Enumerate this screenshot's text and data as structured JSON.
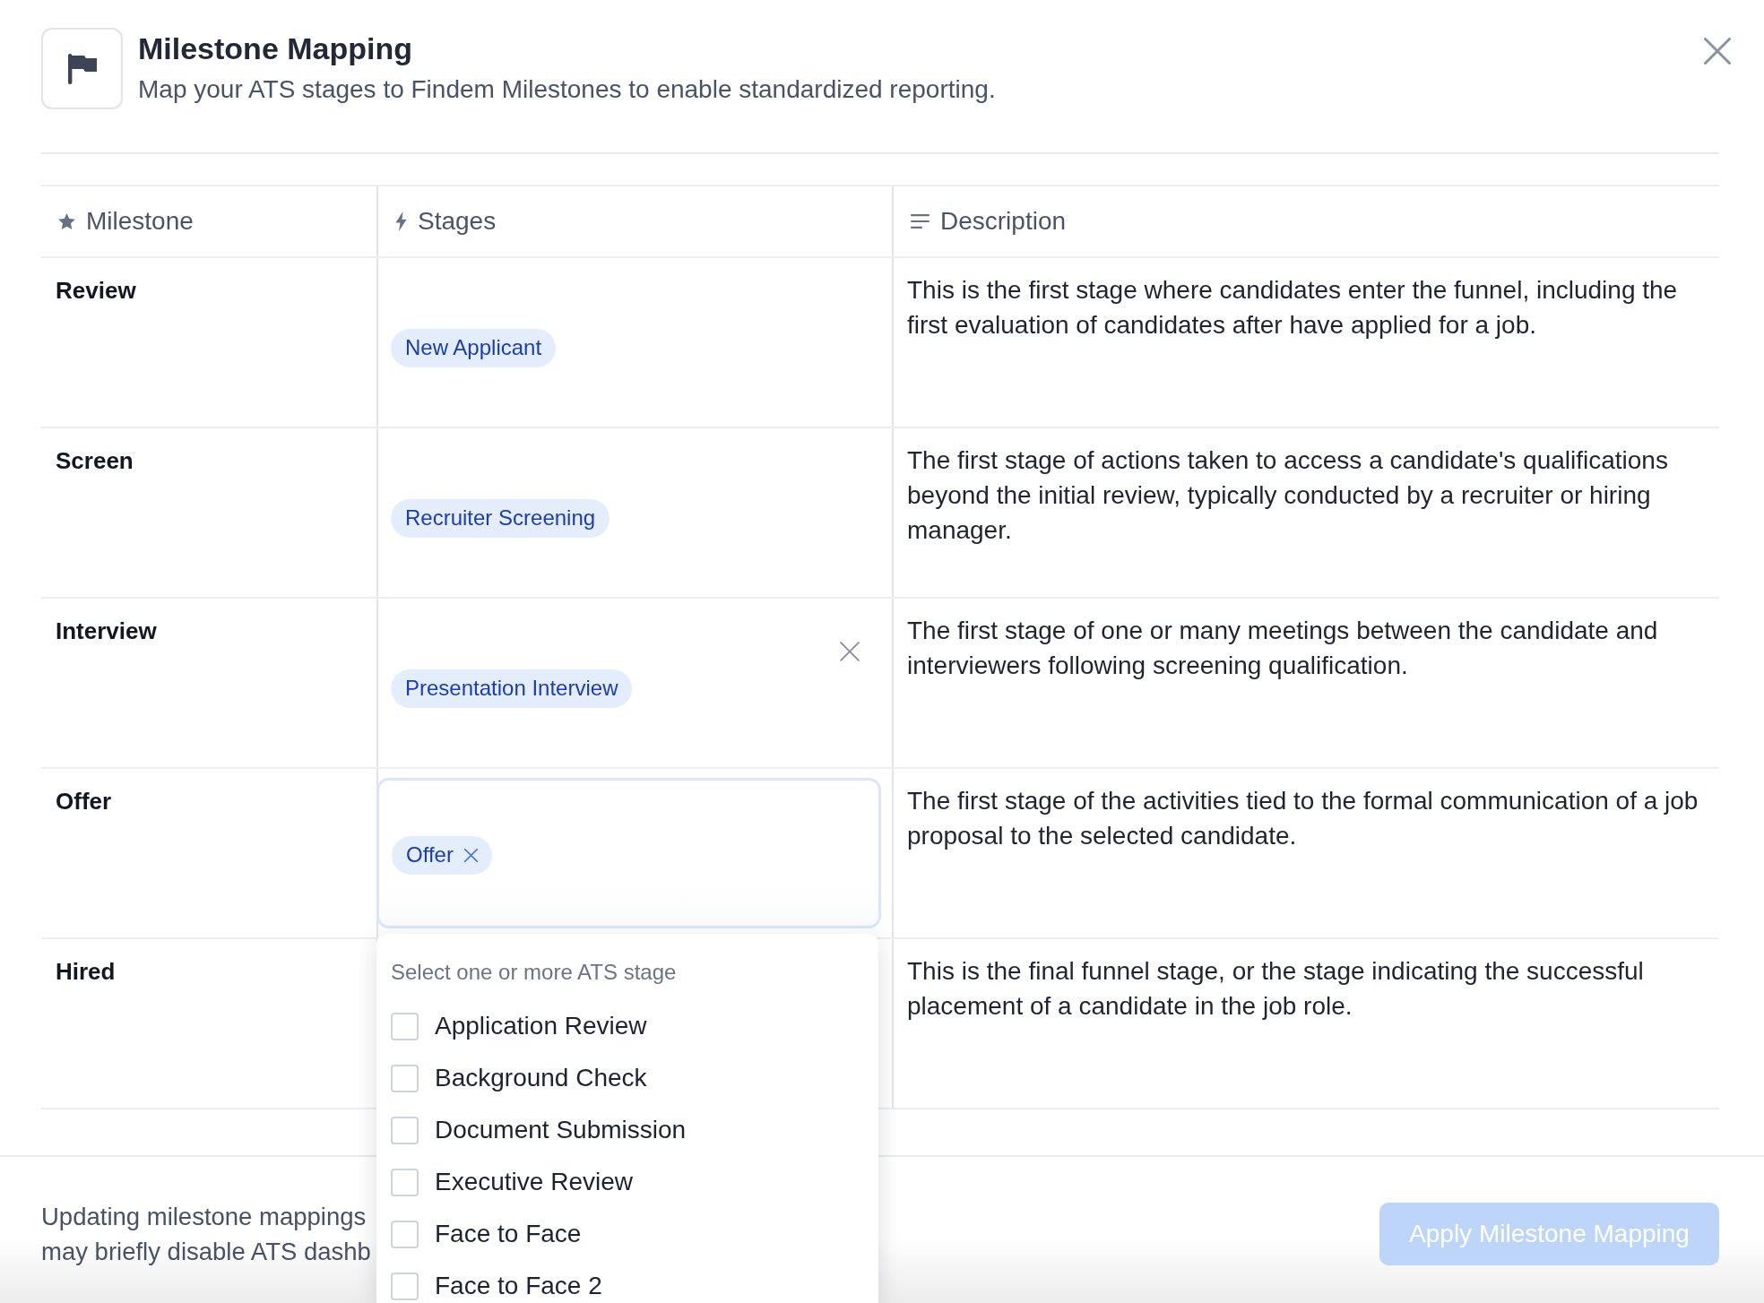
{
  "dialog": {
    "title": "Milestone Mapping",
    "subtitle": "Map your ATS stages to Findem Milestones to enable standardized reporting."
  },
  "table": {
    "columns": [
      {
        "label": "Milestone"
      },
      {
        "label": "Stages"
      },
      {
        "label": "Description"
      }
    ],
    "rows": [
      {
        "milestone": "Review",
        "stages": [
          {
            "label": "New Applicant",
            "removable": false
          }
        ],
        "focused": false,
        "hovered": false,
        "description": "This is the first stage where candidates enter the funnel, including the first evaluation of candidates after have applied for a job."
      },
      {
        "milestone": "Screen",
        "stages": [
          {
            "label": "Recruiter Screening",
            "removable": false
          }
        ],
        "focused": false,
        "hovered": false,
        "description": "The first stage of actions taken to access a candidate's qualifications beyond the initial review, typically conducted by a recruiter or hiring manager."
      },
      {
        "milestone": "Interview",
        "stages": [
          {
            "label": "Presentation Interview",
            "removable": false
          }
        ],
        "focused": false,
        "hovered": true,
        "description": "The first stage of one or many meetings between the candidate and interviewers following screening qualification."
      },
      {
        "milestone": "Offer",
        "stages": [
          {
            "label": "Offer",
            "removable": true
          }
        ],
        "focused": true,
        "hovered": false,
        "description": "The first stage of the activities tied to the formal communication of a job proposal to the selected candidate.",
        "dropdown": {
          "hint": "Select one or more ATS stage",
          "options": [
            {
              "label": "Application Review",
              "checked": false
            },
            {
              "label": "Background Check",
              "checked": false
            },
            {
              "label": "Document Submission",
              "checked": false
            },
            {
              "label": "Executive Review",
              "checked": false
            },
            {
              "label": "Face to Face",
              "checked": false
            },
            {
              "label": "Face to Face 2",
              "checked": false
            }
          ]
        }
      },
      {
        "milestone": "Hired",
        "focused": false,
        "hovered": false,
        "description": "This is the final funnel stage, or the stage indicating the successful placement of a candidate in the job role."
      }
    ]
  },
  "footer": {
    "note_lines": [
      "Updating milestone mappings",
      "may briefly disable ATS dashb"
    ],
    "button": {
      "label": "Apply Milestone Mapping",
      "disabled": true
    }
  }
}
